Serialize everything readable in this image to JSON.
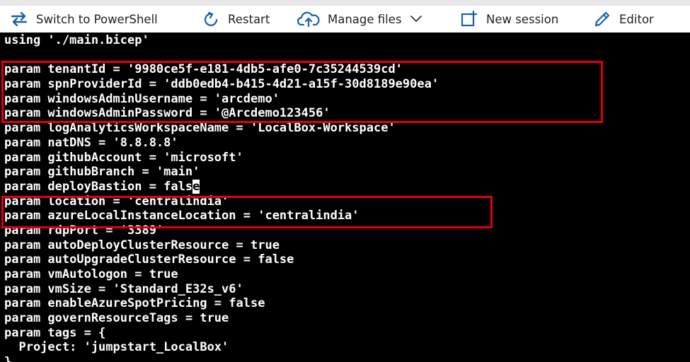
{
  "toolbar": {
    "items": [
      {
        "label": "Switch to PowerShell",
        "icon": "switch-arrows-icon"
      },
      {
        "label": "Restart",
        "icon": "restart-icon"
      },
      {
        "label": "Manage files",
        "icon": "cloud-upload-icon",
        "has_dropdown": true
      },
      {
        "label": "New session",
        "icon": "new-session-icon"
      },
      {
        "label": "Editor",
        "icon": "pencil-icon"
      }
    ]
  },
  "terminal": {
    "background": "#000000",
    "foreground": "#ffffff",
    "highlight_color": "#e0000b",
    "lines": [
      "using './main.bicep'",
      "",
      "param tenantId = '9980ce5f-e181-4db5-afe0-7c35244539cd'",
      "param spnProviderId = 'ddb0edb4-b415-4d21-a15f-30d8189e90ea'",
      "param windowsAdminUsername = 'arcdemo'",
      "param windowsAdminPassword = '@Arcdemo123456'",
      "param logAnalyticsWorkspaceName = 'LocalBox-Workspace'",
      "param natDNS = '8.8.8.8'",
      "param githubAccount = 'microsoft'",
      "param githubBranch = 'main'",
      "param deployBastion = fals",
      "param location = 'centralindia'",
      "param azureLocalInstanceLocation = 'centralindia'",
      "param rdpPort = '3389'",
      "param autoDeployClusterResource = true",
      "param autoUpgradeClusterResource = false",
      "param vmAutologon = true",
      "param vmSize = 'Standard_E32s_v6'",
      "param enableAzureSpotPricing = false",
      "param governResourceTags = true",
      "param tags = {",
      "  Project: 'jumpstart_LocalBox'",
      "}"
    ],
    "cursor_char": "e",
    "highlighted_groups": [
      {
        "lines": [
          2,
          3,
          4,
          5
        ]
      },
      {
        "lines": [
          11,
          12
        ]
      }
    ]
  }
}
